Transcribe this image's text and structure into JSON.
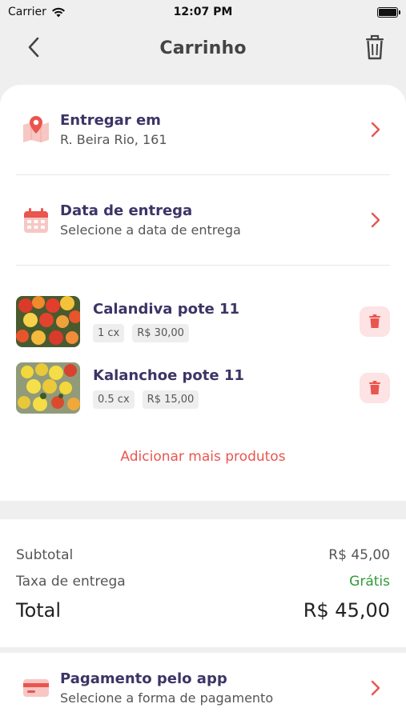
{
  "status_bar": {
    "carrier": "Carrier",
    "time": "12:07 PM"
  },
  "header": {
    "title": "Carrinho",
    "back_icon": "chevron-left-icon",
    "trash_icon": "trash-icon"
  },
  "delivery_address": {
    "label": "Entregar em",
    "value": "R. Beira Rio, 161",
    "icon": "map-pin-icon"
  },
  "delivery_date": {
    "label": "Data de entrega",
    "value": "Selecione a data de entrega",
    "icon": "calendar-icon"
  },
  "products": [
    {
      "name": "Calandiva pote 11",
      "quantity": "1 cx",
      "price": "R$ 30,00"
    },
    {
      "name": "Kalanchoe pote 11",
      "quantity": "0.5 cx",
      "price": "R$ 15,00"
    }
  ],
  "add_more_label": "Adicionar mais produtos",
  "summary": {
    "subtotal_label": "Subtotal",
    "subtotal_value": "R$ 45,00",
    "delivery_fee_label": "Taxa de entrega",
    "delivery_fee_value": "Grátis",
    "total_label": "Total",
    "total_value": "R$ 45,00"
  },
  "payment": {
    "label": "Pagamento pelo app",
    "value": "Selecione a forma de pagamento",
    "icon": "credit-card-icon"
  },
  "colors": {
    "accent": "#e9554f",
    "title_text": "#3b3565",
    "free": "#2f9a3a",
    "icon_bg": "#fde3e3"
  }
}
